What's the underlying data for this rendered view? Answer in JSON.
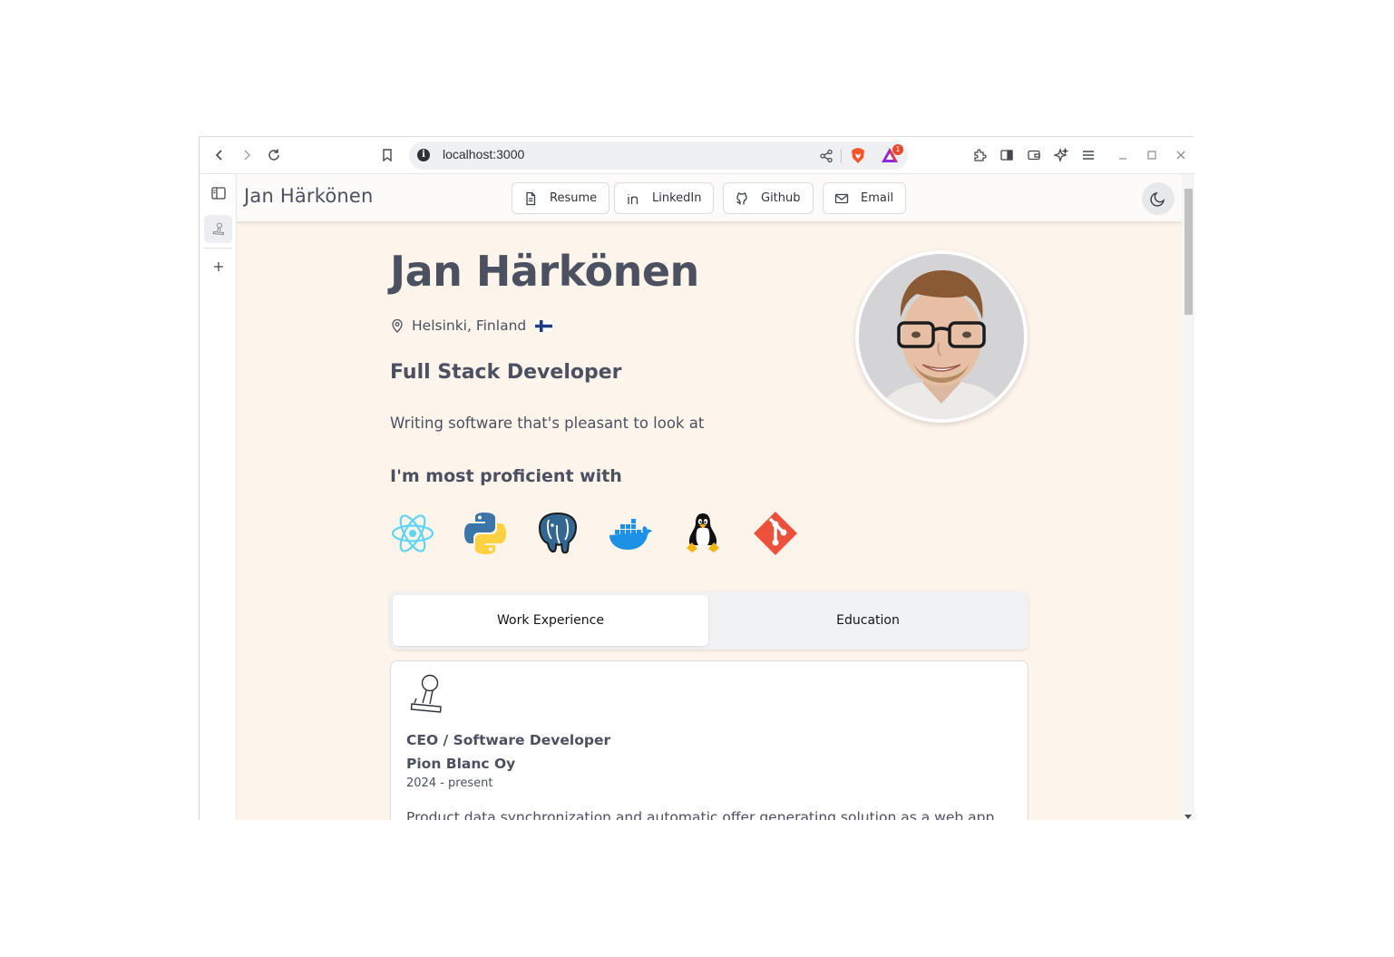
{
  "browser": {
    "url": "localhost:3000",
    "rewards_badge": "1"
  },
  "navbar": {
    "brand": "Jan Härkönen",
    "buttons": [
      {
        "label": "Resume",
        "icon": "document-icon"
      },
      {
        "label": "LinkedIn",
        "icon": "linkedin-icon"
      },
      {
        "label": "Github",
        "icon": "github-icon"
      },
      {
        "label": "Email",
        "icon": "mail-icon"
      }
    ],
    "theme_icon": "moon-icon"
  },
  "hero": {
    "name": "Jan Härkönen",
    "location": "Helsinki, Finland",
    "flag": "finland-flag",
    "title": "Full Stack Developer",
    "tagline": "Writing software that's pleasant to look at",
    "proficient_heading": "I'm most proficient with",
    "technologies": [
      "react-icon",
      "python-icon",
      "postgresql-icon",
      "docker-icon",
      "linux-icon",
      "git-icon"
    ]
  },
  "tabs": {
    "work": "Work Experience",
    "education": "Education",
    "active": "work"
  },
  "experience": [
    {
      "role": "CEO / Software Developer",
      "company": "Pion Blanc Oy",
      "dates": "2024 - present",
      "description": "Product data synchronization and automatic offer generating solution as a web app"
    }
  ]
}
